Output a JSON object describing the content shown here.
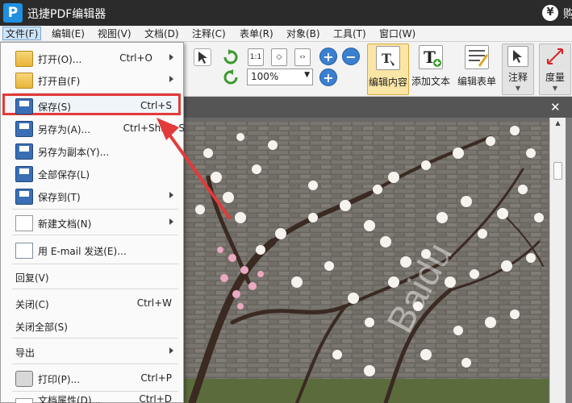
{
  "app": {
    "logo": "P",
    "title": "迅捷PDF编辑器",
    "account_icon": "yen-icon",
    "buy_label": "购买"
  },
  "menubar": [
    {
      "label": "文件(F)"
    },
    {
      "label": "编辑(E)"
    },
    {
      "label": "视图(V)"
    },
    {
      "label": "文档(D)"
    },
    {
      "label": "注释(C)"
    },
    {
      "label": "表单(R)"
    },
    {
      "label": "对象(B)"
    },
    {
      "label": "工具(T)"
    },
    {
      "label": "窗口(W)"
    }
  ],
  "toolbar": {
    "zoom_value": "100%",
    "fit_label": "1:1",
    "zoom_in_symbol": "+",
    "zoom_out_symbol": "−",
    "edit_content": "编辑内容",
    "add_text": "添加文本",
    "edit_form": "编辑表单",
    "annotate": "注释",
    "measure": "度量"
  },
  "file_menu": [
    {
      "label": "打开(O)...",
      "shortcut": "Ctrl+O",
      "submenu": true,
      "icon": "folder-icon"
    },
    {
      "label": "打开自(F)",
      "shortcut": "",
      "submenu": true,
      "icon": "folder-globe-icon"
    },
    {
      "label": "保存(S)",
      "shortcut": "Ctrl+S",
      "submenu": false,
      "icon": "save-icon",
      "highlighted": true
    },
    {
      "label": "另存为(A)...",
      "shortcut": "Ctrl+Shift+S",
      "submenu": false,
      "icon": "save-as-icon"
    },
    {
      "label": "另存为副本(Y)...",
      "shortcut": "",
      "submenu": false,
      "icon": "save-copy-icon"
    },
    {
      "label": "全部保存(L)",
      "shortcut": "",
      "submenu": false,
      "icon": "save-all-icon"
    },
    {
      "label": "保存到(T)",
      "shortcut": "",
      "submenu": true,
      "icon": "save-to-icon"
    },
    {
      "label": "新建文档(N)",
      "shortcut": "",
      "submenu": true,
      "icon": "new-document-icon"
    },
    {
      "label": "用 E-mail 发送(E)...",
      "shortcut": "",
      "submenu": false,
      "icon": "email-icon"
    },
    {
      "label": "回复(V)",
      "shortcut": "",
      "submenu": false,
      "icon": ""
    },
    {
      "label": "关闭(C)",
      "shortcut": "Ctrl+W",
      "submenu": false,
      "icon": ""
    },
    {
      "label": "关闭全部(S)",
      "shortcut": "",
      "submenu": false,
      "icon": ""
    },
    {
      "label": "导出",
      "shortcut": "",
      "submenu": true,
      "icon": ""
    },
    {
      "label": "打印(P)...",
      "shortcut": "Ctrl+P",
      "submenu": false,
      "icon": "print-icon"
    },
    {
      "label": "文档属性(D)...",
      "shortcut": "Ctrl+D",
      "submenu": false,
      "icon": "properties-icon"
    }
  ],
  "document": {
    "close_symbol": "✕",
    "watermark": "Baidu"
  },
  "colors": {
    "highlight": "#e33a3a",
    "accent": "#1f8fe0",
    "selected_tool": "#fbe6a6"
  }
}
